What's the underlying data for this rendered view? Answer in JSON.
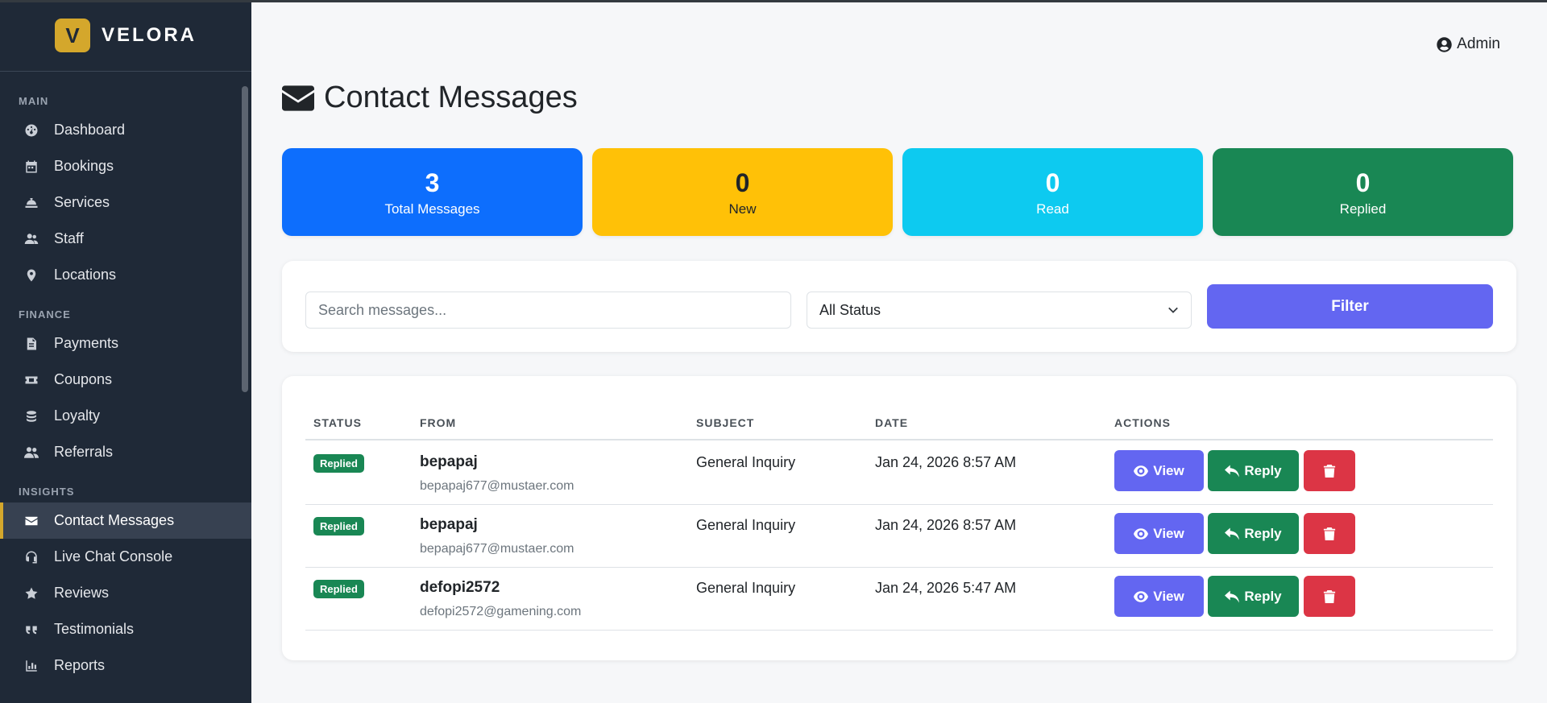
{
  "brand": {
    "logo_letter": "V",
    "name": "VELORA",
    "accent": "#d4a72c"
  },
  "sidebar": {
    "sections": [
      {
        "title": "MAIN",
        "items": [
          {
            "label": "Dashboard",
            "icon": "gauge-icon"
          },
          {
            "label": "Bookings",
            "icon": "calendar-icon"
          },
          {
            "label": "Services",
            "icon": "bell-concierge-icon"
          },
          {
            "label": "Staff",
            "icon": "users-icon"
          },
          {
            "label": "Locations",
            "icon": "map-pin-icon"
          }
        ]
      },
      {
        "title": "FINANCE",
        "items": [
          {
            "label": "Payments",
            "icon": "invoice-icon"
          },
          {
            "label": "Coupons",
            "icon": "ticket-icon"
          },
          {
            "label": "Loyalty",
            "icon": "coins-icon"
          },
          {
            "label": "Referrals",
            "icon": "user-group-icon"
          }
        ]
      },
      {
        "title": "INSIGHTS",
        "items": [
          {
            "label": "Contact Messages",
            "icon": "envelope-icon",
            "active": true
          },
          {
            "label": "Live Chat Console",
            "icon": "headset-icon"
          },
          {
            "label": "Reviews",
            "icon": "star-icon"
          },
          {
            "label": "Testimonials",
            "icon": "quote-icon"
          },
          {
            "label": "Reports",
            "icon": "chart-icon"
          }
        ]
      }
    ]
  },
  "header": {
    "user_label": "Admin"
  },
  "page": {
    "title": "Contact Messages"
  },
  "stats": [
    {
      "value": "3",
      "label": "Total Messages",
      "color": "#0d6efd",
      "text_color": "#ffffff"
    },
    {
      "value": "0",
      "label": "New",
      "color": "#ffc107",
      "text_color": "#212529"
    },
    {
      "value": "0",
      "label": "Read",
      "color": "#0dcaf0",
      "text_color": "#ffffff"
    },
    {
      "value": "0",
      "label": "Replied",
      "color": "#198754",
      "text_color": "#ffffff"
    }
  ],
  "filters": {
    "search_placeholder": "Search messages...",
    "search_value": "",
    "status_selected": "All Status",
    "filter_label": "Filter"
  },
  "table": {
    "columns": {
      "status": "STATUS",
      "from": "FROM",
      "subject": "SUBJECT",
      "date": "DATE",
      "actions": "ACTIONS"
    },
    "rows": [
      {
        "status": "Replied",
        "name": "bepapaj",
        "email": "bepapaj677@mustaer.com",
        "subject": "General Inquiry",
        "date": "Jan 24, 2026 8:57 AM"
      },
      {
        "status": "Replied",
        "name": "bepapaj",
        "email": "bepapaj677@mustaer.com",
        "subject": "General Inquiry",
        "date": "Jan 24, 2026 8:57 AM"
      },
      {
        "status": "Replied",
        "name": "defopi2572",
        "email": "defopi2572@gamening.com",
        "subject": "General Inquiry",
        "date": "Jan 24, 2026 5:47 AM"
      }
    ],
    "actions": {
      "view": "View",
      "reply": "Reply"
    }
  }
}
